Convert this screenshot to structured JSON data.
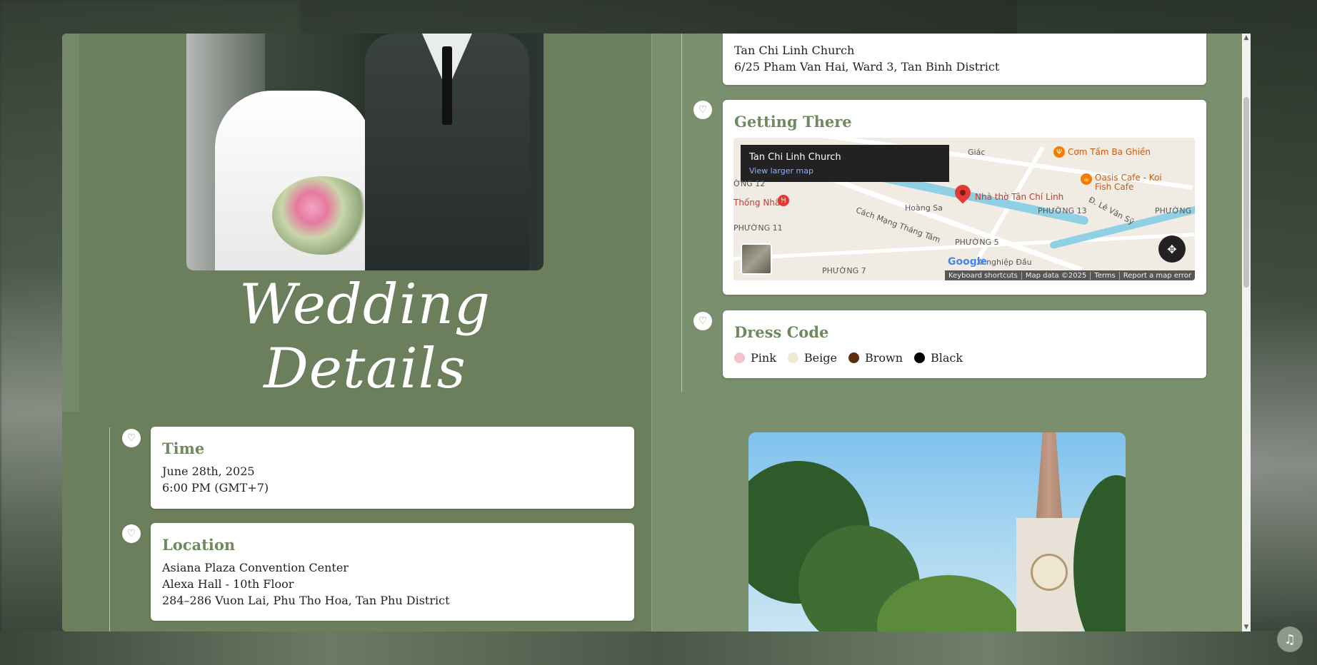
{
  "title": "Wedding Details",
  "time_card": {
    "heading": "Time",
    "date": "June 28th, 2025",
    "time": "6:00 PM (GMT+7)"
  },
  "location_card": {
    "heading": "Location",
    "venue": "Asiana Plaza Convention Center",
    "hall": "Alexa Hall - 10th Floor",
    "address": "284–286 Vuon Lai, Phu Tho Hoa, Tan Phu District"
  },
  "church_card": {
    "name": "Tan Chi Linh Church",
    "address": "6/25 Pham Van Hai, Ward 3, Tan Binh District"
  },
  "getting_there": {
    "heading": "Getting There",
    "map": {
      "place_name": "Tan Chi Linh Church",
      "view_larger": "View larger map",
      "labels": {
        "church": "Nhà thờ Tân Chí Linh",
        "com_tam": "Cơm Tấm Ba Ghiền",
        "oasis": "Oasis Cafe - Koi Fish Cafe",
        "hoang_sa": "Hoàng Sa",
        "cmtt": "Cách Mạng Tháng Tám",
        "thong_nhat": "Thống Nhất",
        "phuong5": "PHƯỜNG 5",
        "phuong7": "PHƯỜNG 7",
        "phuong11": "PHƯỜNG 11",
        "phuong12": "ỜNG 12",
        "phuong13": "PHƯỜNG 13",
        "phuong11b": "PHƯỜNG 11",
        "giac": "Giác",
        "le_van_sy": "Đ. Lê Văn Sỹ",
        "xi_nghiep": "Xí nghiệp Đầu",
        "google": "Google"
      },
      "attribution": [
        "Keyboard shortcuts",
        "Map data ©2025",
        "Terms",
        "Report a map error"
      ]
    }
  },
  "dress_code": {
    "heading": "Dress Code",
    "colors": [
      {
        "name": "Pink",
        "hex": "#f4c2cc"
      },
      {
        "name": "Beige",
        "hex": "#efe9d6"
      },
      {
        "name": "Brown",
        "hex": "#5c2e0e"
      },
      {
        "name": "Black",
        "hex": "#000000"
      }
    ]
  },
  "icons": {
    "timeline_marker": "♡",
    "music": "♫"
  },
  "colors": {
    "accent": "#6f8a5e",
    "panel_left": "#6b7f5c",
    "panel_right": "#7a8f6d"
  }
}
